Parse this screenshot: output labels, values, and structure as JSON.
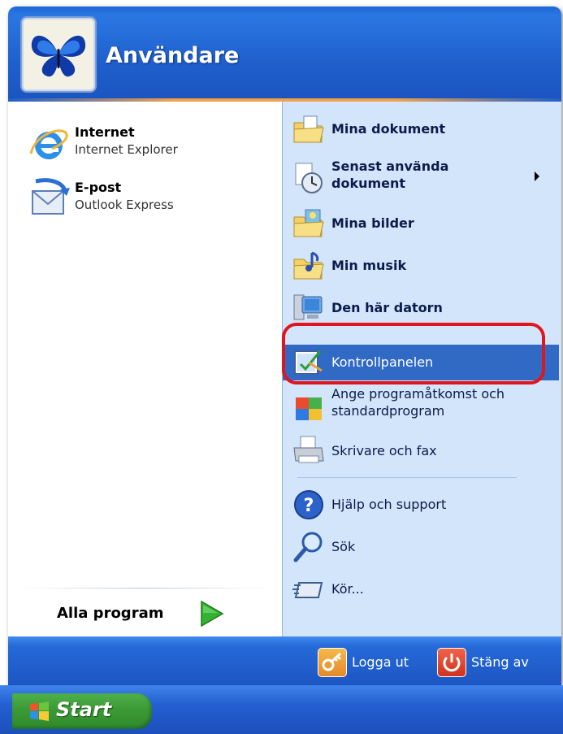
{
  "header": {
    "username": "Användare"
  },
  "left": {
    "pinned": [
      {
        "title": "Internet",
        "subtitle": "Internet Explorer",
        "icon": "internet-explorer-icon"
      },
      {
        "title": "E-post",
        "subtitle": "Outlook Express",
        "icon": "outlook-express-icon"
      }
    ],
    "all_programs": "Alla program"
  },
  "right": {
    "items": [
      {
        "label": "Mina dokument",
        "bold": true,
        "icon": "my-documents-icon"
      },
      {
        "label_line1": "Senast använda",
        "label_line2": "dokument",
        "bold": true,
        "icon": "recent-documents-icon"
      },
      {
        "label": "Mina bilder",
        "bold": true,
        "icon": "my-pictures-icon"
      },
      {
        "label": "Min musik",
        "bold": true,
        "icon": "my-music-icon"
      },
      {
        "label": "Den här datorn",
        "bold": true,
        "icon": "my-computer-icon"
      },
      {
        "label": "Kontrollpanelen",
        "bold": false,
        "selected": true,
        "icon": "control-panel-icon"
      },
      {
        "label_line1": "Ange programåtkomst och",
        "label_line2": "standardprogram",
        "bold": false,
        "icon": "program-access-icon"
      },
      {
        "label": "Skrivare och fax",
        "bold": false,
        "icon": "printer-fax-icon"
      },
      {
        "label": "Hjälp och support",
        "bold": false,
        "icon": "help-icon"
      },
      {
        "label": "Sök",
        "bold": false,
        "icon": "search-icon"
      },
      {
        "label": "Kör...",
        "bold": false,
        "icon": "run-icon"
      }
    ]
  },
  "footer": {
    "logoff": "Logga ut",
    "shutdown": "Stäng av"
  },
  "taskbar": {
    "start": "Start"
  },
  "colors": {
    "header": "#1f5fcc",
    "right_panel": "#d3e5fa",
    "selection": "#316ac5",
    "highlight_ring": "#e0151d",
    "start_green": "#3c9a36"
  }
}
